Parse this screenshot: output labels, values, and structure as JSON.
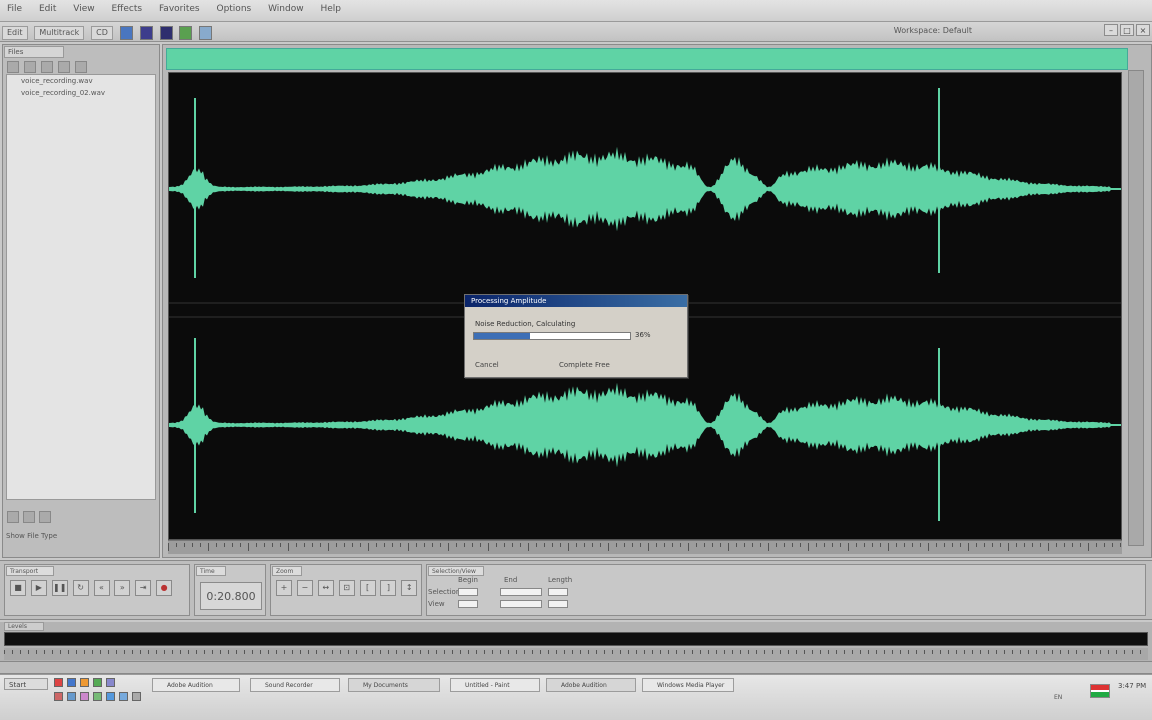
{
  "menubar": {
    "items": [
      "File",
      "Edit",
      "View",
      "Effects",
      "Favorites",
      "Options",
      "Window",
      "Help"
    ]
  },
  "toolbar": {
    "view_buttons": [
      "Edit",
      "Multitrack",
      "CD"
    ],
    "workspace_label": "Workspace: Default"
  },
  "files_panel": {
    "tab_label": "Files",
    "files": [
      "voice_recording.wav",
      "voice_recording_02.wav"
    ],
    "footer_label": "Show File Type"
  },
  "processing_dialog": {
    "title": "Processing Amplitude",
    "status_text": "Noise Reduction, Calculating",
    "percent": "36%",
    "progress_fraction": 0.36,
    "button_cancel": "Cancel",
    "button_secondary": "Complete Free"
  },
  "transport": {
    "tab_label": "Transport",
    "time_tab_label": "Time",
    "time_display": "0:20.800",
    "zoom_tab_label": "Zoom",
    "selection_tab_label": "Selection/View",
    "selection_headers": [
      "Begin",
      "End",
      "Length"
    ],
    "selection_rows": [
      "Selection",
      "View"
    ]
  },
  "levels": {
    "tab_label": "Levels"
  },
  "taskbar": {
    "start_label": "Start",
    "items": [
      "Adobe Audition",
      "Sound Recorder",
      "My Documents",
      "Untitled - Paint",
      "Adobe Audition",
      "Windows Media Player"
    ],
    "clock_time": "3:47 PM",
    "tray_label": "EN"
  },
  "colors": {
    "waveform": "#5fd3a5",
    "waveform_background": "#0b0b0b",
    "dialog_title_start": "#0a246a",
    "progress_fill": "#3d6fb6"
  }
}
